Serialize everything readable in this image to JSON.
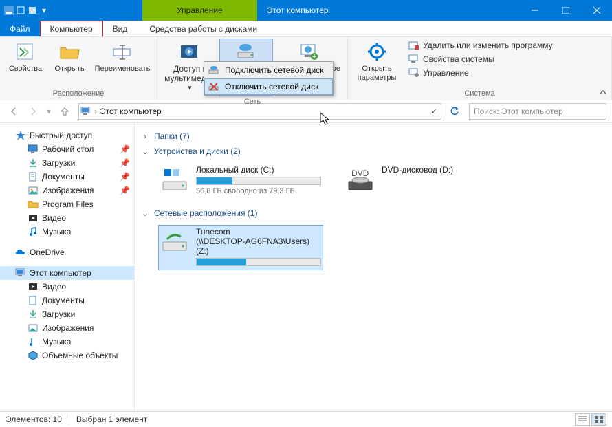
{
  "titlebar": {
    "contextual_label": "Управление",
    "title": "Этот компьютер"
  },
  "tabs": {
    "file": "Файл",
    "computer": "Компьютер",
    "view": "Вид",
    "disk_tools": "Средства работы с дисками"
  },
  "ribbon": {
    "group_location": "Расположение",
    "group_network": "Сеть",
    "group_system": "Система",
    "properties": "Свойства",
    "open": "Открыть",
    "rename": "Переименовать",
    "media_access": "Доступ к мультимедиа",
    "map_drive": "Подключить сетевой диск",
    "add_net_location": "Добавить сетевое расположение",
    "open_settings": "Открыть параметры",
    "uninstall": "Удалить или изменить программу",
    "system_props": "Свойства системы",
    "manage": "Управление"
  },
  "dropdown": {
    "connect": "Подключить сетевой диск",
    "disconnect": "Отключить сетевой диск"
  },
  "address": {
    "text": "Этот компьютер"
  },
  "search": {
    "placeholder": "Поиск: Этот компьютер"
  },
  "tree": {
    "quick_access": "Быстрый доступ",
    "desktop": "Рабочий стол",
    "downloads": "Загрузки",
    "documents": "Документы",
    "pictures": "Изображения",
    "program_files": "Program Files",
    "videos": "Видео",
    "music": "Музыка",
    "onedrive": "OneDrive",
    "this_pc": "Этот компьютер",
    "videos2": "Видео",
    "documents2": "Документы",
    "downloads2": "Загрузки",
    "pictures2": "Изображения",
    "music2": "Музыка",
    "objects3d": "Объемные объекты"
  },
  "content": {
    "folders_header": "Папки (7)",
    "devices_header": "Устройства и диски (2)",
    "network_header": "Сетевые расположения (1)",
    "local_disk": {
      "name": "Локальный диск (C:)",
      "sub": "56,6 ГБ свободно из 79,3 ГБ",
      "fill_pct": 29
    },
    "dvd": {
      "name": "DVD-дисковод (D:)"
    },
    "net_drive": {
      "name": "Tunecom",
      "path": "(\\\\DESKTOP-AG6FNA3\\Users) (Z:)",
      "fill_pct": 40
    }
  },
  "status": {
    "elements": "Элементов: 10",
    "selected": "Выбран 1 элемент"
  }
}
